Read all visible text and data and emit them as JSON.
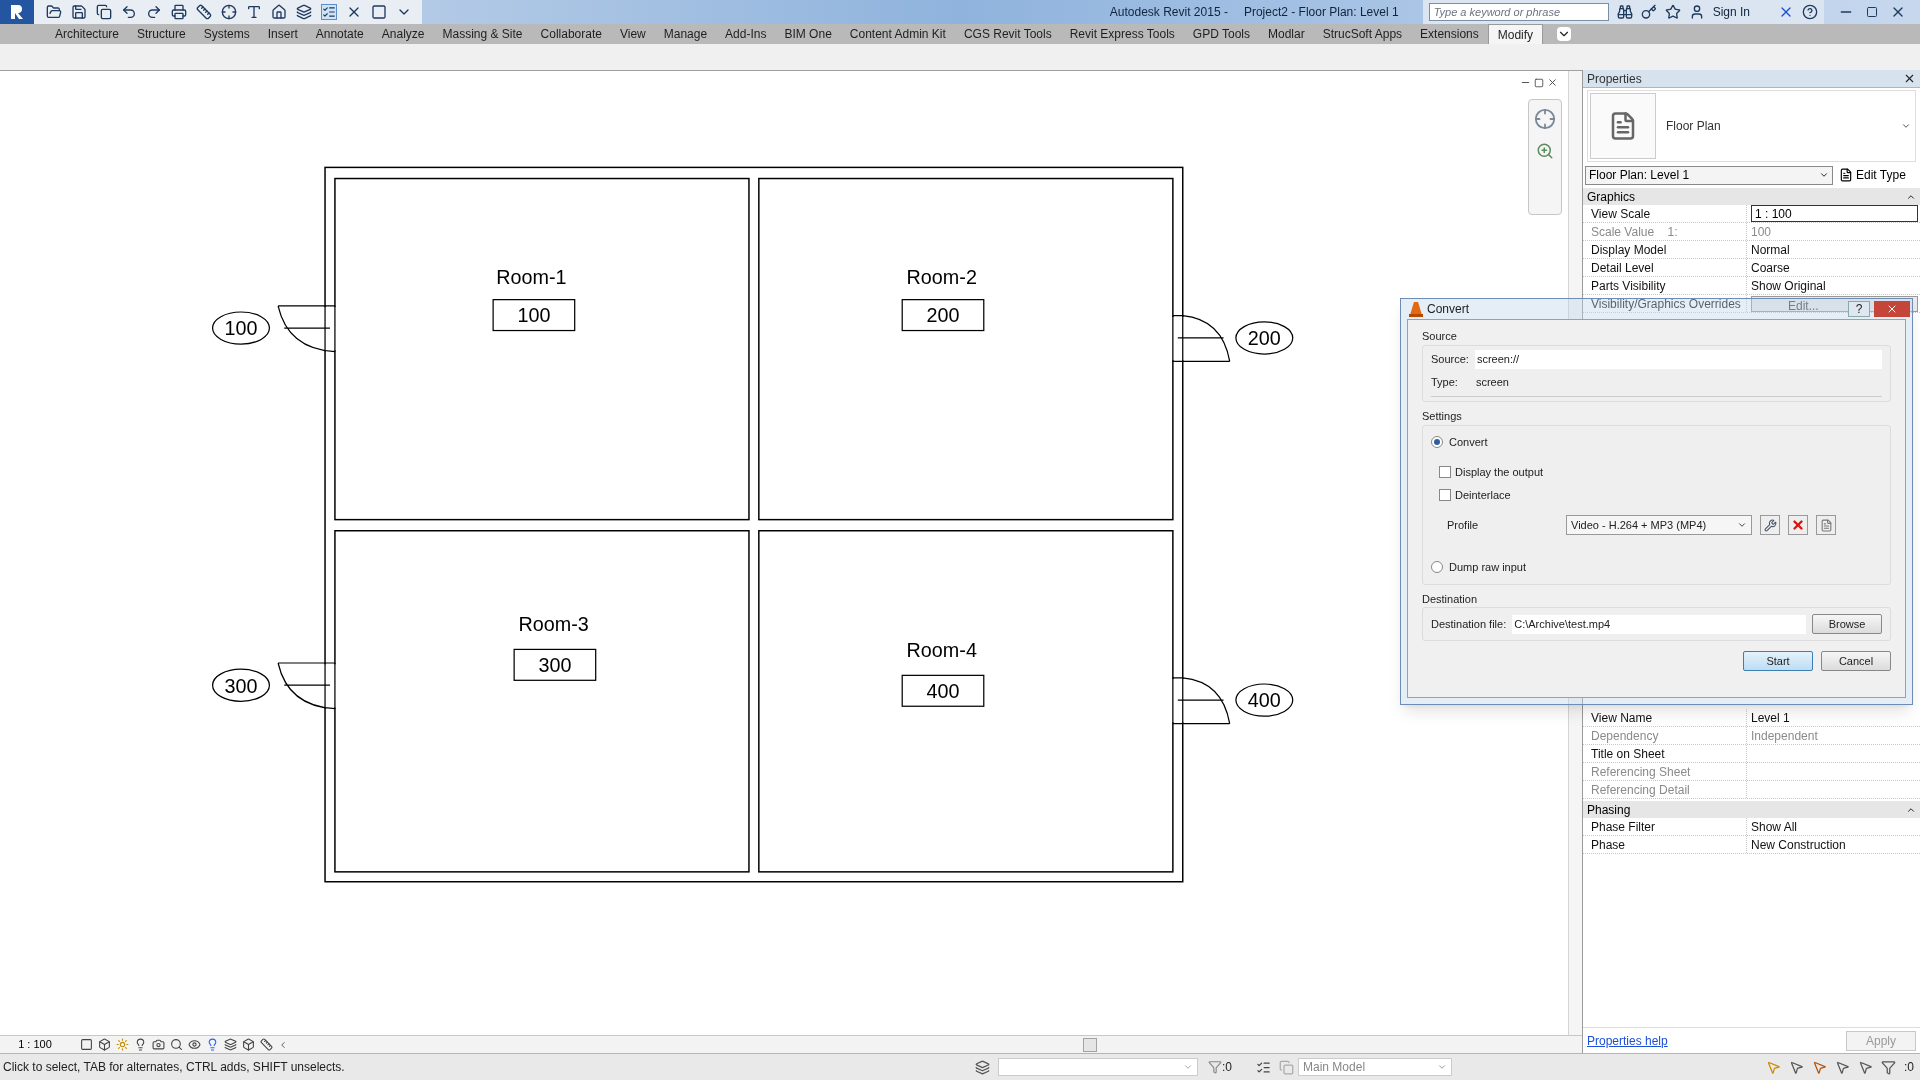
{
  "title_bar": {
    "app": "Autodesk Revit 2015 -",
    "document": "Project2 - Floor Plan: Level 1",
    "search": {
      "placeholder": "Type a keyword or phrase"
    },
    "sign_in": "Sign In"
  },
  "ribbon_tabs": [
    {
      "label": "Architecture",
      "selected": false
    },
    {
      "label": "Structure",
      "selected": false
    },
    {
      "label": "Systems",
      "selected": false
    },
    {
      "label": "Insert",
      "selected": false
    },
    {
      "label": "Annotate",
      "selected": false
    },
    {
      "label": "Analyze",
      "selected": false
    },
    {
      "label": "Massing & Site",
      "selected": false
    },
    {
      "label": "Collaborate",
      "selected": false
    },
    {
      "label": "View",
      "selected": false
    },
    {
      "label": "Manage",
      "selected": false
    },
    {
      "label": "Add-Ins",
      "selected": false
    },
    {
      "label": "BIM One",
      "selected": false
    },
    {
      "label": "Content Admin Kit",
      "selected": false
    },
    {
      "label": "CGS Revit Tools",
      "selected": false
    },
    {
      "label": "Revit Express Tools",
      "selected": false
    },
    {
      "label": "GPD Tools",
      "selected": false
    },
    {
      "label": "Modlar",
      "selected": false
    },
    {
      "label": "StrucSoft Apps",
      "selected": false
    },
    {
      "label": "Extensions",
      "selected": false
    },
    {
      "label": "Modify",
      "selected": true
    }
  ],
  "floor_plan": {
    "rooms": [
      {
        "name": "Room-1",
        "number": "100"
      },
      {
        "name": "Room-2",
        "number": "200"
      },
      {
        "name": "Room-3",
        "number": "300"
      },
      {
        "name": "Room-4",
        "number": "400"
      }
    ],
    "door_tags": [
      "100",
      "200",
      "300",
      "400"
    ]
  },
  "view_control_bar": {
    "scale": "1 : 100"
  },
  "properties": {
    "title": "Properties",
    "type_name": "Floor Plan",
    "type_selector": "Floor Plan: Level 1",
    "edit_type": "Edit Type",
    "groups": [
      {
        "title": "Graphics",
        "rows": [
          {
            "name": "View Scale",
            "value": "1 : 100",
            "kind": "input",
            "disabled": false
          },
          {
            "name": "Scale Value    1:",
            "value": "100",
            "kind": "text",
            "disabled": true
          },
          {
            "name": "Display Model",
            "value": "Normal",
            "kind": "text",
            "disabled": false
          },
          {
            "name": "Detail Level",
            "value": "Coarse",
            "kind": "text",
            "disabled": false
          },
          {
            "name": "Parts Visibility",
            "value": "Show Original",
            "kind": "text",
            "disabled": false
          },
          {
            "name": "Visibility/Graphics Overrides",
            "value": "Edit...",
            "kind": "button",
            "disabled": false
          }
        ]
      },
      {
        "rows": [
          {
            "name": "View Name",
            "value": "Level 1",
            "kind": "text",
            "disabled": false
          },
          {
            "name": "Dependency",
            "value": "Independent",
            "kind": "text",
            "disabled": true
          },
          {
            "name": "Title on Sheet",
            "value": "",
            "kind": "text",
            "disabled": false
          },
          {
            "name": "Referencing Sheet",
            "value": "",
            "kind": "text",
            "disabled": true
          },
          {
            "name": "Referencing Detail",
            "value": "",
            "kind": "text",
            "disabled": true
          }
        ]
      },
      {
        "title": "Phasing",
        "rows": [
          {
            "name": "Phase Filter",
            "value": "Show All",
            "kind": "text",
            "disabled": false
          },
          {
            "name": "Phase",
            "value": "New Construction",
            "kind": "text",
            "disabled": false
          }
        ]
      }
    ],
    "help_link": "Properties help",
    "apply": {
      "label": "Apply",
      "disabled": true
    }
  },
  "convert_dialog": {
    "title": "Convert",
    "help": "?",
    "source": {
      "title": "Source",
      "source_label": "Source:",
      "source_value": "screen://",
      "type_label": "Type:",
      "type_value": "screen"
    },
    "settings": {
      "title": "Settings",
      "convert": {
        "label": "Convert",
        "selected": true
      },
      "options": [
        {
          "label": "Display the output",
          "checked": false
        },
        {
          "label": "Deinterlace",
          "checked": false
        }
      ],
      "profile_label": "Profile",
      "profile_value": "Video - H.264 + MP3 (MP4)",
      "dump_raw": {
        "label": "Dump raw input",
        "selected": false
      }
    },
    "destination": {
      "title": "Destination",
      "file_label": "Destination file:",
      "file_value": "C:\\Archive\\test.mp4",
      "browse": "Browse"
    },
    "buttons": [
      {
        "label": "Start",
        "default": true
      },
      {
        "label": "Cancel",
        "default": false
      }
    ]
  },
  "status_bar": {
    "message": "Click to select, TAB for alternates, CTRL adds, SHIFT unselects.",
    "worksets_count": ":0",
    "model": "Main Model",
    "filter_count": ":0"
  }
}
